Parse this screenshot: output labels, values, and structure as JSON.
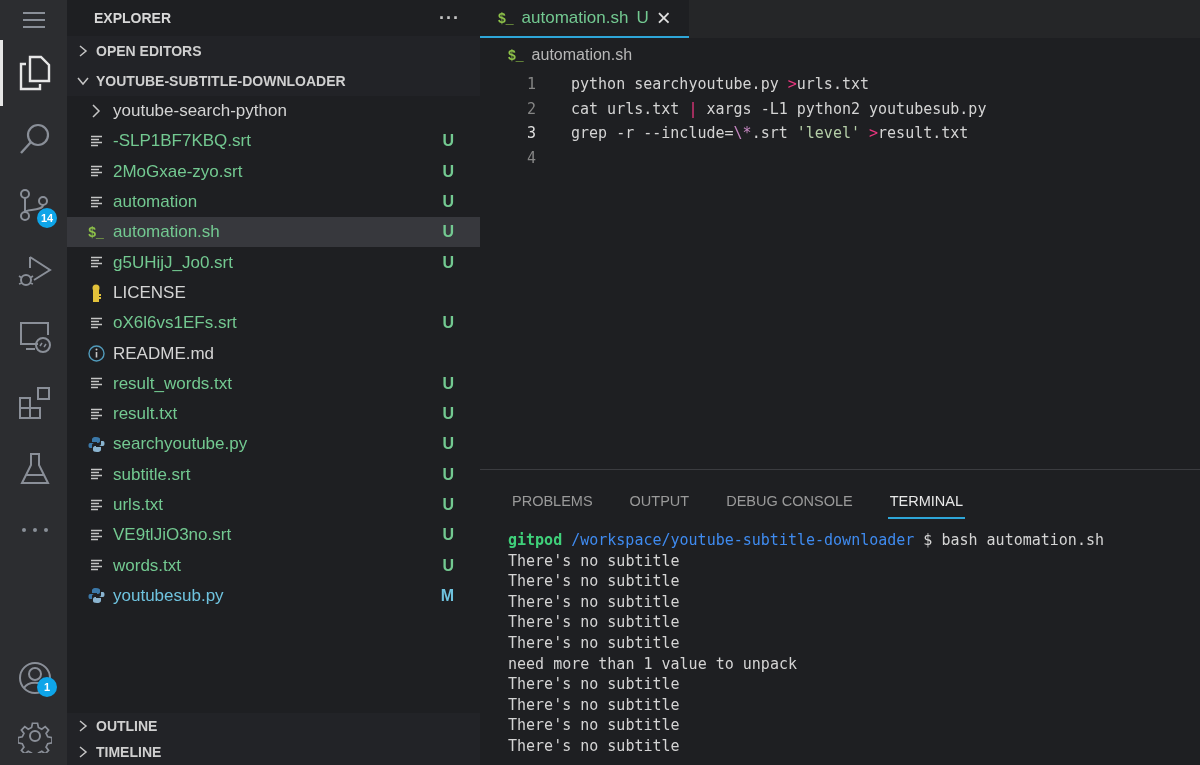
{
  "activity_bar": {
    "items": [
      {
        "kind": "files",
        "selected": true
      },
      {
        "kind": "search",
        "selected": false
      },
      {
        "kind": "source-control",
        "selected": false,
        "badge": "14"
      },
      {
        "kind": "run",
        "selected": false
      },
      {
        "kind": "remote",
        "selected": false
      },
      {
        "kind": "extensions",
        "selected": false
      },
      {
        "kind": "flask",
        "selected": false
      },
      {
        "kind": "more",
        "selected": false
      }
    ],
    "bottom_items": [
      {
        "kind": "account",
        "badge": "1"
      },
      {
        "kind": "settings"
      }
    ]
  },
  "sidebar": {
    "title": "EXPLORER",
    "more": "···",
    "sections_top": [
      {
        "label": "OPEN EDITORS",
        "expanded": false
      },
      {
        "label": "YOUTUBE-SUBTITLE-DOWNLOADER",
        "expanded": true
      }
    ],
    "items": [
      {
        "name": "youtube-search-python",
        "kind": "folder",
        "expanded": false,
        "selected": false
      },
      {
        "name": "-SLP1BF7KBQ.srt",
        "kind": "text",
        "status": "U",
        "selected": false
      },
      {
        "name": "2MoGxae-zyo.srt",
        "kind": "text",
        "status": "U",
        "selected": false
      },
      {
        "name": "automation",
        "kind": "text",
        "status": "U",
        "selected": false
      },
      {
        "name": "automation.sh",
        "kind": "shell",
        "status": "U",
        "selected": true
      },
      {
        "name": "g5UHijJ_Jo0.srt",
        "kind": "text",
        "status": "U",
        "selected": false
      },
      {
        "name": "LICENSE",
        "kind": "license",
        "selected": false
      },
      {
        "name": "oX6l6vs1EFs.srt",
        "kind": "text",
        "status": "U",
        "selected": false
      },
      {
        "name": "README.md",
        "kind": "info",
        "selected": false
      },
      {
        "name": "result_words.txt",
        "kind": "text",
        "status": "U",
        "selected": false
      },
      {
        "name": "result.txt",
        "kind": "text",
        "status": "U",
        "selected": false
      },
      {
        "name": "searchyoutube.py",
        "kind": "python",
        "status": "U",
        "selected": false
      },
      {
        "name": "subtitle.srt",
        "kind": "text",
        "status": "U",
        "selected": false
      },
      {
        "name": "urls.txt",
        "kind": "text",
        "status": "U",
        "selected": false
      },
      {
        "name": "VE9tlJiO3no.srt",
        "kind": "text",
        "status": "U",
        "selected": false
      },
      {
        "name": "words.txt",
        "kind": "text",
        "status": "U",
        "selected": false
      },
      {
        "name": "youtubesub.py",
        "kind": "python",
        "status": "M",
        "selected": false
      }
    ],
    "sections_bottom": [
      {
        "label": "OUTLINE",
        "expanded": false
      },
      {
        "label": "TIMELINE",
        "expanded": false
      }
    ]
  },
  "editor": {
    "tabs": [
      {
        "icon": "$_",
        "name": "automation.sh",
        "status": "U",
        "selected": true,
        "close": "×"
      }
    ],
    "breadcrumb": {
      "icon": "$_",
      "name": "automation.sh"
    },
    "lines": [
      {
        "number": "1",
        "current": false,
        "tokens": [
          {
            "kind": "plain",
            "text": "python searchyoutube.py "
          },
          {
            "kind": "operator",
            "text": ">"
          },
          {
            "kind": "plain",
            "text": "urls.txt"
          }
        ]
      },
      {
        "number": "2",
        "current": false,
        "tokens": [
          {
            "kind": "plain",
            "text": "cat urls.txt "
          },
          {
            "kind": "operator",
            "text": "|"
          },
          {
            "kind": "plain",
            "text": " xargs -L1 python2 youtubesub.py"
          }
        ]
      },
      {
        "number": "3",
        "current": true,
        "tokens": [
          {
            "kind": "plain",
            "text": "grep -r --include="
          },
          {
            "kind": "escape",
            "text": "\\*"
          },
          {
            "kind": "plain",
            "text": ".srt "
          },
          {
            "kind": "string",
            "text": "'level'"
          },
          {
            "kind": "operator",
            "text": " >"
          },
          {
            "kind": "plain",
            "text": "result.txt"
          }
        ]
      },
      {
        "number": "4",
        "current": false
      }
    ]
  },
  "panel": {
    "tabs": [
      {
        "label": "PROBLEMS",
        "selected": false
      },
      {
        "label": "OUTPUT",
        "selected": false
      },
      {
        "label": "DEBUG CONSOLE",
        "selected": false
      },
      {
        "label": "TERMINAL",
        "selected": true
      }
    ],
    "terminal": {
      "prompt": {
        "user": "gitpod",
        "path": "/workspace/youtube-subtitle-downloader",
        "command": "$ bash automation.sh"
      },
      "output": [
        "There's no subtitle",
        "There's no subtitle",
        "There's no subtitle",
        "There's no subtitle",
        "There's no subtitle",
        "need more than 1 value to unpack",
        "There's no subtitle",
        "There's no subtitle",
        "There's no subtitle",
        "There's no subtitle"
      ]
    }
  }
}
